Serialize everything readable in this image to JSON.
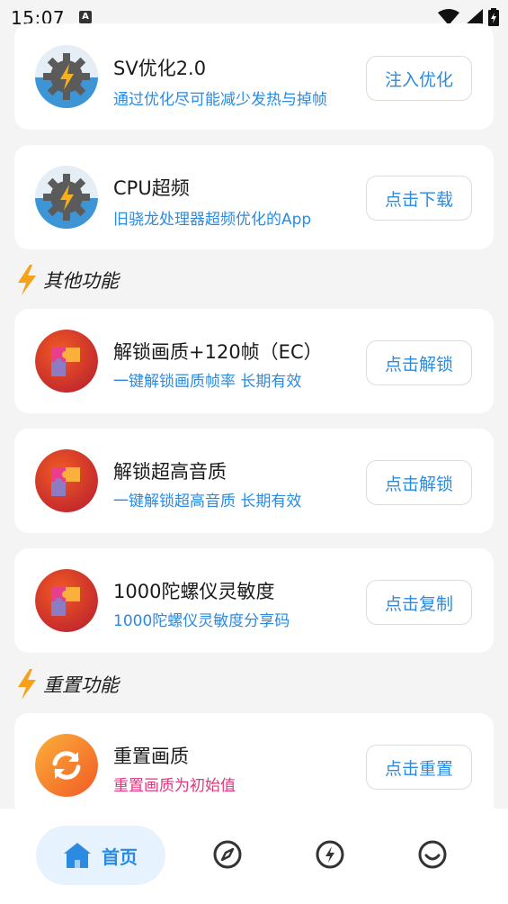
{
  "status_bar": {
    "time": "15:07",
    "notification_icon": "A"
  },
  "cards_top": [
    {
      "title": "SV优化2.0",
      "subtitle": "通过优化尽可能减少发热与掉帧",
      "button": "注入优化",
      "icon": "gear-lightning-icon"
    },
    {
      "title": "CPU超频",
      "subtitle": "旧骁龙处理器超频优化的App",
      "button": "点击下载",
      "icon": "gear-lightning-icon"
    }
  ],
  "section_other": {
    "title": "其他功能",
    "icon": "lightning-bolt-icon"
  },
  "cards_other": [
    {
      "title": "解锁画质+120帧（EC）",
      "subtitle": "一键解锁画质帧率 长期有效",
      "button": "点击解锁",
      "icon": "puzzle-icon"
    },
    {
      "title": "解锁超高音质",
      "subtitle": "一键解锁超高音质 长期有效",
      "button": "点击解锁",
      "icon": "puzzle-icon"
    },
    {
      "title": "1000陀螺仪灵敏度",
      "subtitle": "1000陀螺仪灵敏度分享码",
      "button": "点击复制",
      "icon": "puzzle-icon"
    }
  ],
  "section_reset": {
    "title": "重置功能",
    "icon": "lightning-bolt-icon"
  },
  "cards_reset": [
    {
      "title": "重置画质",
      "subtitle": "重置画质为初始值",
      "button": "点击重置",
      "icon": "refresh-icon"
    }
  ],
  "bottom_nav": {
    "home_label": "首页",
    "items": [
      "home-icon",
      "compass-icon",
      "lightning-circle-icon",
      "smile-icon"
    ]
  },
  "colors": {
    "accent": "#2a8be0",
    "pink": "#e0367c",
    "background": "#f4f4f4"
  }
}
